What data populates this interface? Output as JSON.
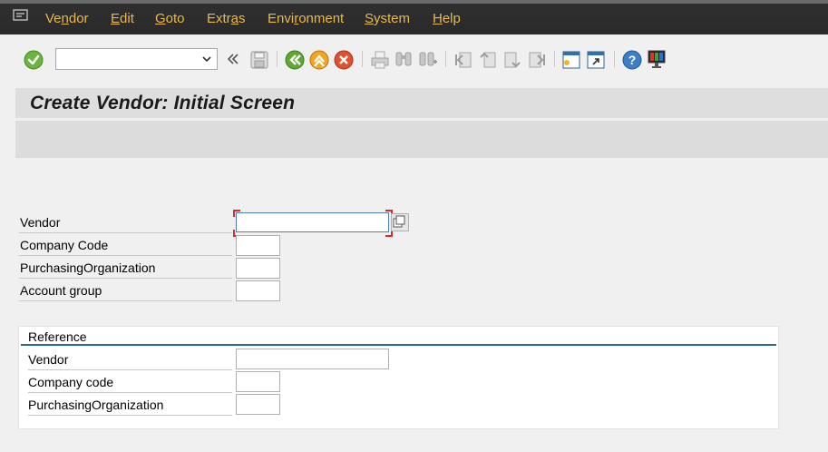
{
  "menu": {
    "items": [
      {
        "pre": "Ve",
        "ul": "n",
        "post": "dor"
      },
      {
        "pre": "",
        "ul": "E",
        "post": "dit"
      },
      {
        "pre": "",
        "ul": "G",
        "post": "oto"
      },
      {
        "pre": "Extr",
        "ul": "a",
        "post": "s"
      },
      {
        "pre": "Envi",
        "ul": "r",
        "post": "onment"
      },
      {
        "pre": "",
        "ul": "S",
        "post": "ystem"
      },
      {
        "pre": "",
        "ul": "H",
        "post": "elp"
      }
    ]
  },
  "toolbar": {
    "command_field_value": "",
    "icons": [
      "enter-icon",
      "save-icon",
      "back-icon",
      "exit-icon",
      "cancel-icon",
      "print-icon",
      "find-icon",
      "find-next-icon",
      "first-page-icon",
      "previous-page-icon",
      "next-page-icon",
      "last-page-icon",
      "create-session-icon",
      "generate-shortcut-icon",
      "help-icon",
      "customize-layout-icon"
    ]
  },
  "screen": {
    "title": "Create Vendor:  Initial Screen"
  },
  "form": {
    "vendor_label": "Vendor",
    "vendor_value": "",
    "company_code_label": "Company Code",
    "company_code_value": "",
    "purch_org_label": "PurchasingOrganization",
    "purch_org_value": "",
    "account_group_label": "Account group",
    "account_group_value": ""
  },
  "reference": {
    "title": "Reference",
    "vendor_label": "Vendor",
    "vendor_value": "",
    "company_code_label": "Company code",
    "company_code_value": "",
    "purch_org_label": "PurchasingOrganization",
    "purch_org_value": ""
  },
  "colors": {
    "menu_text": "#e8b94a",
    "menu_bg": "#2a2a2a",
    "focus_corner": "#d92b2b",
    "group_line": "#2b6a96"
  }
}
